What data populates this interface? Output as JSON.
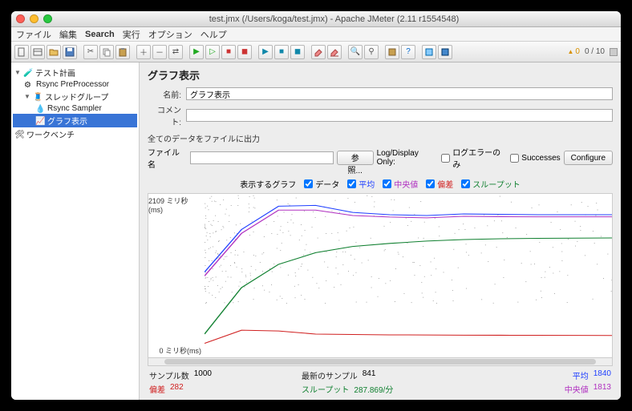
{
  "title": "test.jmx (/Users/koga/test.jmx) - Apache JMeter (2.11 r1554548)",
  "menu": {
    "file": "ファイル",
    "edit": "編集",
    "search": "Search",
    "run": "実行",
    "options": "オプション",
    "help": "ヘルプ"
  },
  "toolbar_right": {
    "warnings": "0",
    "counter": "0 / 10"
  },
  "tree": {
    "plan": "テスト計画",
    "preproc": "Rsync PreProcessor",
    "group": "スレッドグループ",
    "sampler": "Rsync Sampler",
    "graph": "グラフ表示",
    "workbench": "ワークベンチ"
  },
  "panel": {
    "title": "グラフ表示",
    "name_label": "名前:",
    "name_value": "グラフ表示",
    "comment_label": "コメント:",
    "comment_value": "",
    "file_section": "全てのデータをファイルに出力",
    "filename_label": "ファイル名",
    "filename_value": "",
    "browse_btn": "参照...",
    "logdisplay_label": "Log/Display Only:",
    "errors_only": "ログエラーのみ",
    "successes": "Successes",
    "configure_btn": "Configure"
  },
  "legend": {
    "title": "表示するグラフ",
    "data": "データ",
    "avg": "平均",
    "median": "中央値",
    "dev": "偏差",
    "throughput": "スループット"
  },
  "yaxis": {
    "top": "2109 ミリ秒(ms)",
    "bottom": "0 ミリ秒(ms)"
  },
  "stats": {
    "samples_label": "サンプル数",
    "samples": "1000",
    "latest_label": "最新のサンプル",
    "latest": "841",
    "avg_label": "平均",
    "avg": "1840",
    "dev_label": "偏差",
    "dev": "282",
    "thr_label": "スループット",
    "thr": "287.869/分",
    "med_label": "中央値",
    "med": "1813"
  },
  "chart_data": {
    "type": "line",
    "ylim": [
      0,
      2109
    ],
    "ylabel": "ミリ秒(ms)",
    "series": [
      {
        "name": "平均",
        "color": "#2040ff",
        "values": [
          1100,
          1650,
          1950,
          1960,
          1870,
          1840,
          1830,
          1850,
          1845,
          1840,
          1840,
          1840
        ]
      },
      {
        "name": "中央値",
        "color": "#b030c0",
        "values": [
          1050,
          1600,
          1900,
          1900,
          1830,
          1810,
          1800,
          1820,
          1815,
          1813,
          1813,
          1813
        ]
      },
      {
        "name": "スループット",
        "color": "#108030",
        "values": [
          300,
          900,
          1200,
          1350,
          1430,
          1470,
          1500,
          1520,
          1530,
          1535,
          1538,
          1540
        ]
      },
      {
        "name": "偏差",
        "color": "#d02020",
        "values": [
          180,
          350,
          340,
          300,
          295,
          290,
          288,
          286,
          285,
          284,
          283,
          282
        ]
      }
    ],
    "scatter": {
      "name": "データ",
      "color": "#333",
      "ymin": 700,
      "ymax": 2100,
      "count": 400,
      "denser_low_x": true
    }
  }
}
